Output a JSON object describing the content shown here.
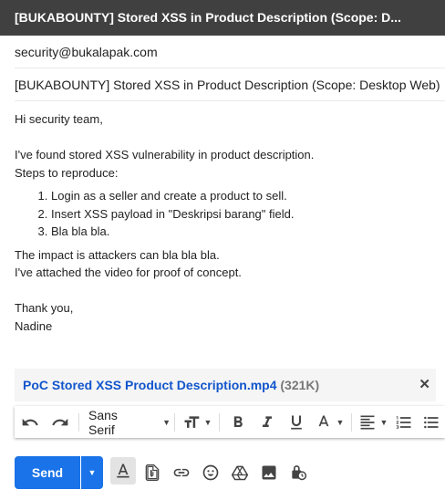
{
  "window": {
    "title": "[BUKABOUNTY] Stored XSS in Product Description (Scope: D..."
  },
  "compose": {
    "to": "security@bukalapak.com",
    "subject": "[BUKABOUNTY] Stored XSS in Product Description (Scope: Desktop Web)"
  },
  "body": {
    "greeting": "Hi security team,",
    "intro_line1": "I've found stored XSS vulnerability in product description.",
    "intro_line2": "Steps to reproduce:",
    "steps": [
      "Login as a seller and create a product to sell.",
      "Insert XSS payload in \"Deskripsi barang\" field.",
      "Bla bla bla."
    ],
    "impact_line1": "The impact is attackers can bla bla bla.",
    "impact_line2": "I've attached the video for proof of concept.",
    "closing": "Thank you,",
    "signature": "Nadine"
  },
  "attachment": {
    "name": "PoC Stored XSS Product Description.mp4",
    "size": "(321K)"
  },
  "toolbar": {
    "font": "Sans Serif"
  },
  "actions": {
    "send_label": "Send"
  },
  "colors": {
    "titlebar": "#404040",
    "accent": "#1a73e8",
    "link": "#1155cc"
  }
}
